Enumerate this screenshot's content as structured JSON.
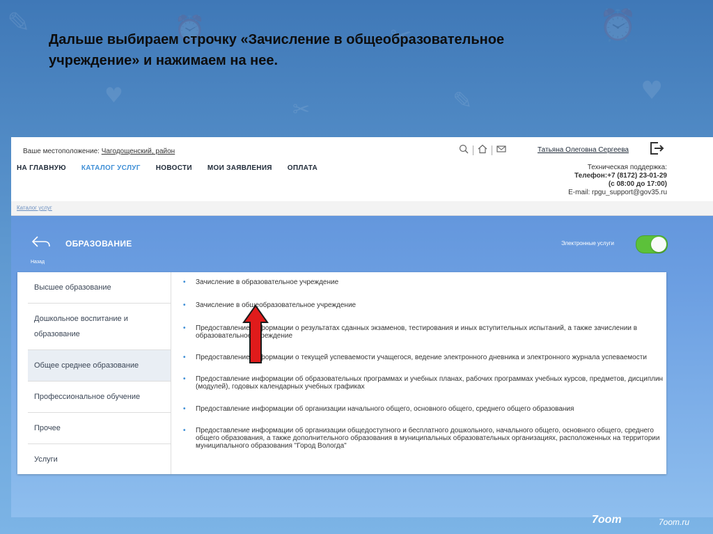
{
  "slide": {
    "instruction": "Дальше выбираем строчку «Зачисление в общеобразовательное учреждение» и нажимаем на нее."
  },
  "header": {
    "location_label": "Ваше местоположение:",
    "location_value": "Чагодощенский, район",
    "nav": [
      "НА ГЛАВНУЮ",
      "КАТАЛОГ УСЛУГ",
      "НОВОСТИ",
      "МОИ ЗАЯВЛЕНИЯ",
      "ОПЛАТА"
    ],
    "active_nav": "КАТАЛОГ УСЛУГ",
    "user_name": "Татьяна Олеговна Сергеева",
    "support": {
      "title": "Техническая поддержка:",
      "phone": "Телефон:+7 (8172) 23-01-29",
      "hours": "(с 08:00 до 17:00)",
      "email": "E-mail: rpgu_support@gov35.ru"
    }
  },
  "breadcrumb": "Каталог услуг",
  "section": {
    "title": "ОБРАЗОВАНИЕ",
    "back_label": "Назад",
    "toggle_label": "Электронные услуги",
    "toggle_on": true
  },
  "categories": [
    "Высшее образование",
    "Дошкольное воспитание и образование",
    "Общее среднее образование",
    "Профессиональное обучение",
    "Прочее",
    "Услуги"
  ],
  "active_category": "Общее среднее образование",
  "services": [
    "Зачисление в образовательное учреждение",
    "Зачисление в общеобразовательное учреждение",
    "Предоставление информации о результатах сданных экзаменов, тестирования и иных вступительных испытаний, а также зачислении в образовательное учреждение",
    "Предоставление информации о текущей успеваемости учащегося, ведение электронного дневника и электронного журнала успеваемости",
    "Предоставление информации об образовательных программах и учебных планах, рабочих программах учебных курсов, предметов, дисциплин (модулей), годовых календарных учебных графиках",
    "Предоставление информации об организации начального общего, основного общего, среднего общего образования",
    "Предоставление информации об организации общедоступного и бесплатного дошкольного, начального общего, основного общего, среднего общего образования, а также дополнительного образования в муниципальных образовательных организациях, расположенных на территории муниципального образования \"Город Вологда\""
  ],
  "icons": [
    "search-icon",
    "home-icon",
    "mail-icon",
    "logout-icon",
    "back-arrow-icon",
    "bullet-icon"
  ],
  "colors": {
    "accent": "#3f8fd6",
    "toggle": "#5cc13a",
    "arrow": "#e01b1b"
  },
  "watermark": {
    "logo": "7oom",
    "site": "7oom.ru"
  }
}
